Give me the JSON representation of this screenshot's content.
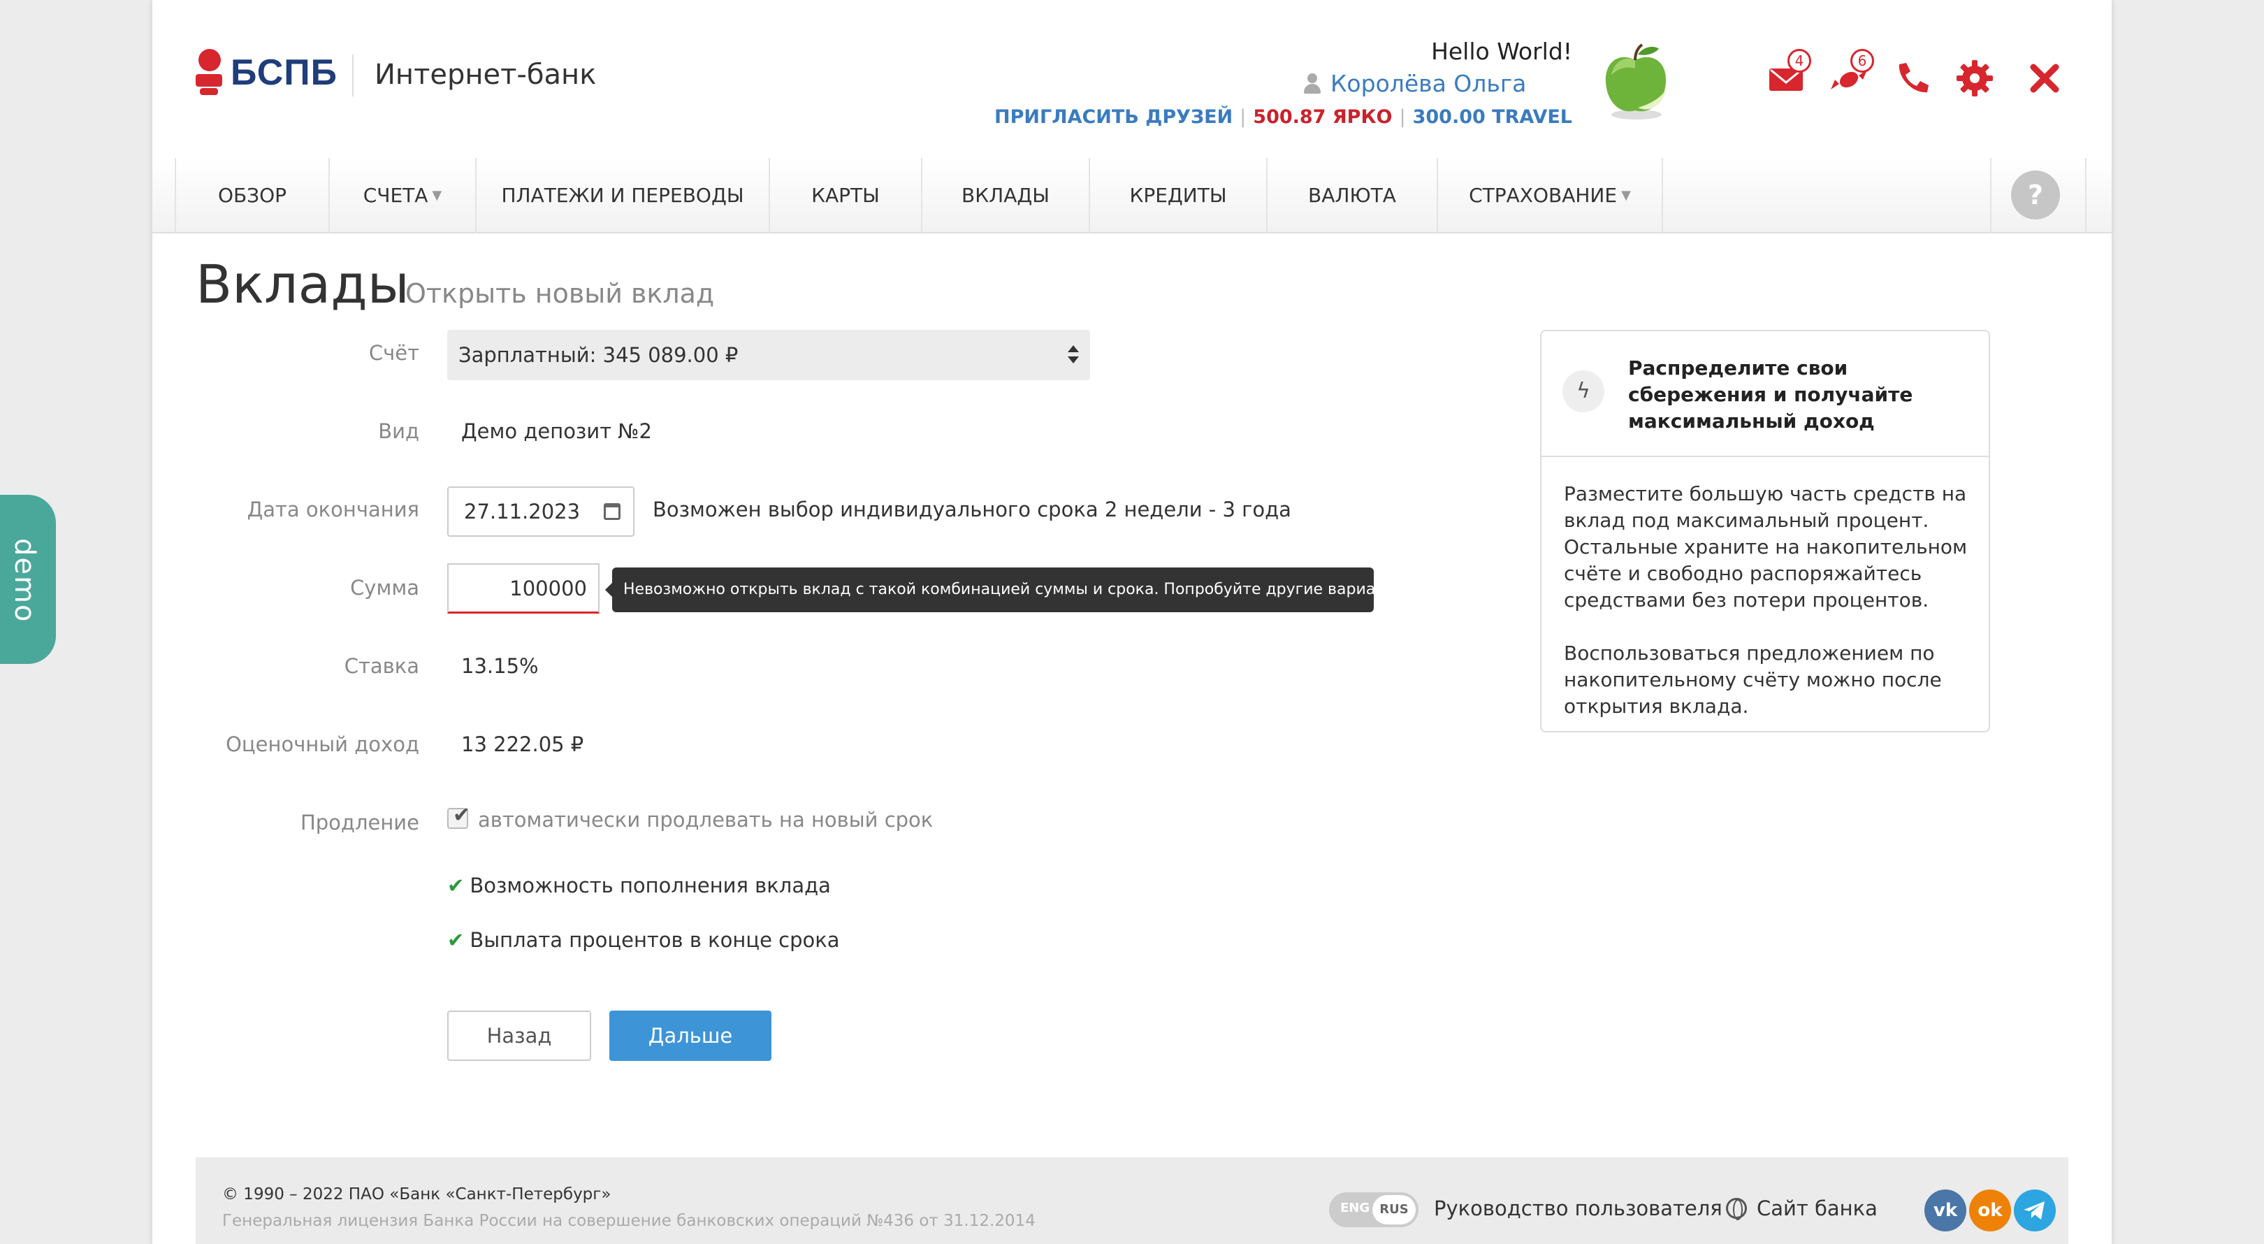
{
  "side_tab": {
    "label": "demo"
  },
  "header": {
    "brand": "БСПБ",
    "caption": "Интернет-банк",
    "greeting": "Hello World!",
    "user_name": "Королёва Ольга",
    "invite_link": "ПРИГЛАСИТЬ ДРУЗЕЙ",
    "bonus_yarko": "500.87 ЯРКО",
    "bonus_travel": "300.00 TRAVEL",
    "mail_count": "4",
    "gifts_count": "6",
    "icons": [
      "mail-icon",
      "candy-icon",
      "phone-icon",
      "gear-icon",
      "close-icon"
    ]
  },
  "nav": {
    "items": [
      "ОБЗОР",
      "СЧЕТА",
      "ПЛАТЕЖИ И ПЕРЕВОДЫ",
      "КАРТЫ",
      "ВКЛАДЫ",
      "КРЕДИТЫ",
      "ВАЛЮТА",
      "СТРАХОВАНИЕ"
    ],
    "help": "?"
  },
  "page": {
    "title": "Вклады",
    "subtitle": "Открыть новый вклад"
  },
  "form": {
    "account_label": "Счёт",
    "account_value": "Зарплатный: 345 089.00 ₽",
    "type_label": "Вид",
    "type_value": "Демо депозит №2",
    "end_date_label": "Дата окончания",
    "end_date_value": "27.11.2023",
    "end_date_hint": "Возможен выбор индивидуального срока 2 недели - 3 года",
    "amount_label": "Сумма",
    "amount_value": "100000",
    "amount_error": "Невозможно открыть вклад с такой комбинацией суммы и срока. Попробуйте другие варианты.",
    "rate_label": "Ставка",
    "rate_value": "13.15%",
    "income_label": "Оценочный доход",
    "income_value": "13 222.05 ₽",
    "renewal_label": "Продление",
    "renewal_checkbox": "автоматически продлевать на новый срок",
    "feature_1": "Возможность пополнения вклада",
    "feature_2": "Выплата процентов в конце срока",
    "back_button": "Назад",
    "next_button": "Дальше"
  },
  "promo": {
    "title": "Распределите свои сбережения и получайте максимальный доход",
    "paragraph_1": "Разместите большую часть средств на вклад под максимальный процент. Остальные храните на накопительном счёте и свободно распоряжайтесь средствами без потери процентов.",
    "paragraph_2": "Воспользоваться предложением по накопительному счёту можно после открытия вклада."
  },
  "footer": {
    "copyright": "© 1990 – 2022 ПАО «Банк «Санкт-Петербург»",
    "license": "Генеральная лицензия Банка России на совершение банковских операций №436 от 31.12.2014",
    "lang_eng": "ENG",
    "lang_rus": "RUS",
    "guide_link": "Руководство пользователя",
    "site_link": "Сайт банка",
    "social": [
      "vk-icon",
      "odnoklassniki-icon",
      "telegram-icon"
    ]
  },
  "colors": {
    "accent_red": "#d7262e",
    "brand_blue": "#1f3d7a",
    "link_blue": "#3a7bbf",
    "button_blue": "#3d94d6",
    "demo_teal": "#4aa89b"
  }
}
